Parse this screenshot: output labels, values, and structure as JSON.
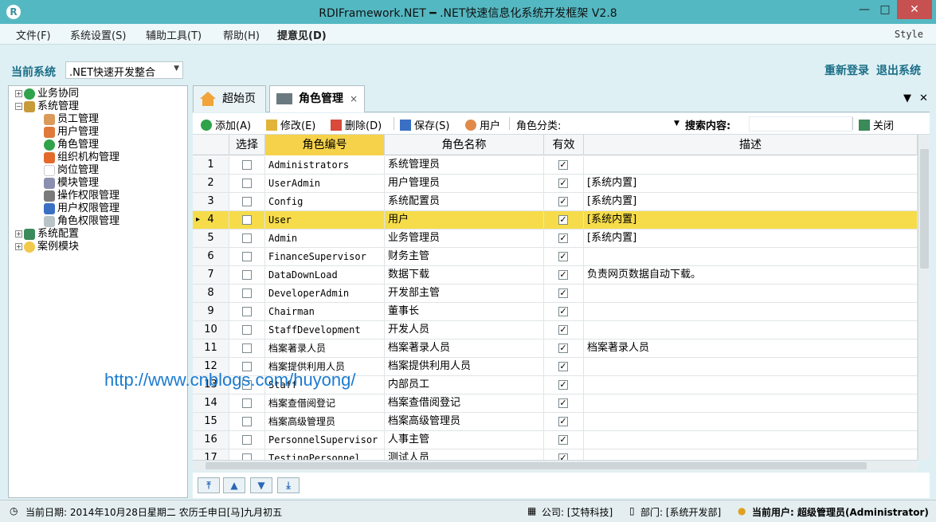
{
  "window": {
    "title": "RDIFramework.NET ━ .NET快速信息化系统开发框架 V2.8",
    "app_icon": "R",
    "min": "—",
    "max": "□",
    "close": "✕"
  },
  "menu": {
    "file": "文件(F)",
    "settings": "系统设置(S)",
    "tools": "辅助工具(T)",
    "help": "帮助(H)",
    "feedback": "提意见(D)",
    "style": "Style"
  },
  "system_bar": {
    "label": "当前系统",
    "selected": ".NET快速开发整合",
    "relogin": "重新登录",
    "exit": "退出系统"
  },
  "tree": {
    "n0": "业务协同",
    "n1": "系统管理",
    "n1a": "员工管理",
    "n1b": "用户管理",
    "n1c": "角色管理",
    "n1d": "组织机构管理",
    "n1e": "岗位管理",
    "n1f": "模块管理",
    "n1g": "操作权限管理",
    "n1h": "用户权限管理",
    "n1i": "角色权限管理",
    "n2": "系统配置",
    "n3": "案例模块"
  },
  "tabs": {
    "home": "超始页",
    "roles": "角色管理",
    "close": "×",
    "menu_arrow": "▼",
    "tab_close": "✕"
  },
  "toolbar": {
    "add": "添加(A)",
    "edit": "修改(E)",
    "delete": "删除(D)",
    "save": "保存(S)",
    "users": "用户",
    "category_label": "角色分类:",
    "category_value": "",
    "search_label": "搜索内容:",
    "search_value": "",
    "close": "关闭"
  },
  "grid": {
    "headers": {
      "select": "选择",
      "code": "角色编号",
      "name": "角色名称",
      "valid": "有效",
      "desc": "描述"
    },
    "rows": [
      {
        "num": "1",
        "code": "Administrators",
        "name": "系统管理员",
        "valid": "✓",
        "desc": ""
      },
      {
        "num": "2",
        "code": "UserAdmin",
        "name": "用户管理员",
        "valid": "✓",
        "desc": "[系统内置]"
      },
      {
        "num": "3",
        "code": "Config",
        "name": "系统配置员",
        "valid": "✓",
        "desc": "[系统内置]"
      },
      {
        "num": "4",
        "code": "User",
        "name": "用户",
        "valid": "✓",
        "desc": "[系统内置]"
      },
      {
        "num": "5",
        "code": "Admin",
        "name": "业务管理员",
        "valid": "✓",
        "desc": "[系统内置]"
      },
      {
        "num": "6",
        "code": "FinanceSupervisor",
        "name": "财务主管",
        "valid": "✓",
        "desc": ""
      },
      {
        "num": "7",
        "code": "DataDownLoad",
        "name": "数据下载",
        "valid": "✓",
        "desc": "负责网页数据自动下载。"
      },
      {
        "num": "8",
        "code": "DeveloperAdmin",
        "name": "开发部主管",
        "valid": "✓",
        "desc": ""
      },
      {
        "num": "9",
        "code": "Chairman",
        "name": "董事长",
        "valid": "✓",
        "desc": ""
      },
      {
        "num": "10",
        "code": "StaffDevelopment",
        "name": "开发人员",
        "valid": "✓",
        "desc": ""
      },
      {
        "num": "11",
        "code": "档案著录人员",
        "name": "档案著录人员",
        "valid": "✓",
        "desc": "档案著录人员"
      },
      {
        "num": "12",
        "code": "档案提供利用人员",
        "name": "档案提供利用人员",
        "valid": "✓",
        "desc": ""
      },
      {
        "num": "13",
        "code": "Staff",
        "name": "内部员工",
        "valid": "✓",
        "desc": ""
      },
      {
        "num": "14",
        "code": "档案查借阅登记",
        "name": "档案查借阅登记",
        "valid": "✓",
        "desc": ""
      },
      {
        "num": "15",
        "code": "档案高级管理员",
        "name": "档案高级管理员",
        "valid": "✓",
        "desc": ""
      },
      {
        "num": "16",
        "code": "PersonnelSupervisor",
        "name": "人事主管",
        "valid": "✓",
        "desc": ""
      },
      {
        "num": "17",
        "code": "TestingPersonnel",
        "name": "测试人员",
        "valid": "✓",
        "desc": ""
      }
    ]
  },
  "pager": {
    "first": "⤒",
    "prev": "▲",
    "next": "▼",
    "last": "⤓"
  },
  "status": {
    "date": "当前日期: 2014年10月28日星期二 农历壬申日[马]九月初五",
    "company": "公司: [艾特科技]",
    "dept": "部门: [系统开发部]",
    "user": "当前用户: 超级管理员(Administrator)"
  },
  "watermark": "http://www.cnblogs.com/huyong/",
  "colors": {
    "titlebar": "#54b8c2",
    "highlight_row": "#f6dc4a",
    "accent_text": "#1a6e86",
    "close_button": "#c75050"
  }
}
